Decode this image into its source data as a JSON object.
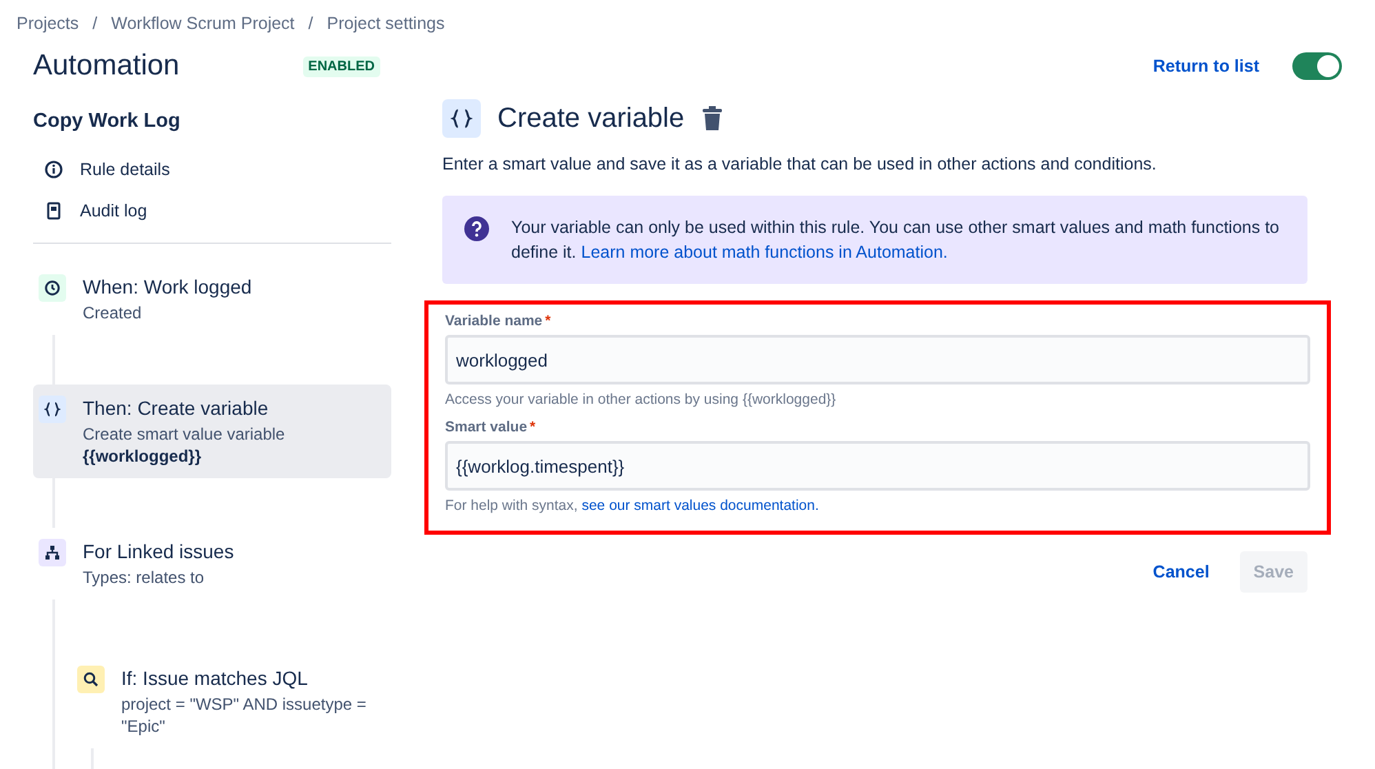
{
  "breadcrumbs": {
    "separator": "/",
    "items": [
      "Projects",
      "Workflow Scrum Project",
      "Project settings"
    ]
  },
  "header": {
    "title": "Automation",
    "status_badge": "ENABLED",
    "return_link": "Return to list",
    "toggle_on": true
  },
  "rule": {
    "name": "Copy Work Log",
    "links": [
      {
        "kind": "info",
        "label": "Rule details"
      },
      {
        "kind": "log",
        "label": "Audit log"
      }
    ]
  },
  "steps": [
    {
      "kind": "trigger",
      "title": "When: Work logged",
      "description": "Created",
      "selected": false
    },
    {
      "kind": "action",
      "title": "Then: Create variable",
      "description": "Create smart value variable\n**{{worklogged}}**",
      "selected": true
    },
    {
      "kind": "branch",
      "title": "For Linked issues",
      "description": "Types: relates to",
      "selected": false,
      "children": [
        {
          "kind": "condition",
          "title": "If: Issue matches JQL",
          "description": "project = \"WSP\" AND issuetype =\n\"Epic\"",
          "selected": false
        }
      ]
    }
  ],
  "panel": {
    "title": "Create variable",
    "description": "Enter a smart value and save it as a variable that can be used in other actions and conditions.",
    "notice": {
      "text": "Your variable can only be used within this rule. You can use other smart values and math functions to define it.",
      "link": "Learn more about math functions in Automation."
    },
    "form": {
      "highlighted": true,
      "fields": [
        {
          "label": "Variable name",
          "required_mark": "*",
          "value": "worklogged",
          "help": "Access your variable in other actions by using {{worklogged}}"
        },
        {
          "label": "Smart value",
          "required_mark": "*",
          "value": "{{worklog.timespent}}",
          "help": "For help with syntax,",
          "help_link": "see our smart values documentation."
        }
      ]
    },
    "buttons": [
      {
        "kind": "subtle",
        "label": "Cancel",
        "disabled": false
      },
      {
        "kind": "primary",
        "label": "Save",
        "disabled": true
      }
    ]
  }
}
